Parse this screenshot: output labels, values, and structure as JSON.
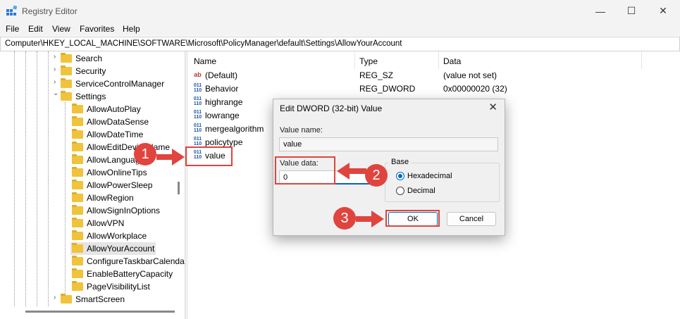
{
  "window": {
    "title": "Registry Editor",
    "minimize": "—",
    "maximize": "☐",
    "close": "✕"
  },
  "menu": [
    "File",
    "Edit",
    "View",
    "Favorites",
    "Help"
  ],
  "address": "Computer\\HKEY_LOCAL_MACHINE\\SOFTWARE\\Microsoft\\PolicyManager\\default\\Settings\\AllowYourAccount",
  "tree": {
    "top": [
      {
        "label": "Search",
        "expander": "›"
      },
      {
        "label": "Security",
        "expander": "›"
      },
      {
        "label": "ServiceControlManager",
        "expander": "›"
      },
      {
        "label": "Settings",
        "expander": "⌄"
      }
    ],
    "children": [
      "AllowAutoPlay",
      "AllowDataSense",
      "AllowDateTime",
      "AllowEditDeviceName",
      "AllowLanguage",
      "AllowOnlineTips",
      "AllowPowerSleep",
      "AllowRegion",
      "AllowSignInOptions",
      "AllowVPN",
      "AllowWorkplace",
      "AllowYourAccount",
      "ConfigureTaskbarCalendar",
      "EnableBatteryCapacity",
      "PageVisibilityList"
    ],
    "bottom": {
      "label": "SmartScreen",
      "expander": "›"
    },
    "selected": "AllowYourAccount"
  },
  "list": {
    "headers": {
      "name": "Name",
      "type": "Type",
      "data": "Data"
    },
    "rows": [
      {
        "icon": "ab",
        "name": "(Default)",
        "type": "REG_SZ",
        "data": "(value not set)"
      },
      {
        "icon": "011\n110",
        "name": "Behavior",
        "type": "REG_DWORD",
        "data": "0x00000020 (32)"
      },
      {
        "icon": "011\n110",
        "name": "highrange",
        "type": "",
        "data": ""
      },
      {
        "icon": "011\n110",
        "name": "lowrange",
        "type": "",
        "data": ""
      },
      {
        "icon": "011\n110",
        "name": "mergealgorithm",
        "type": "",
        "data": ""
      },
      {
        "icon": "011\n110",
        "name": "policytype",
        "type": "",
        "data": ""
      },
      {
        "icon": "011\n110",
        "name": "value",
        "type": "",
        "data": ""
      }
    ]
  },
  "dialog": {
    "title": "Edit DWORD (32-bit) Value",
    "close": "✕",
    "value_name_label": "Value name:",
    "value_name": "value",
    "value_data_label": "Value data:",
    "value_data": "0",
    "base_label": "Base",
    "hex_label": "Hexadecimal",
    "dec_label": "Decimal",
    "ok": "OK",
    "cancel": "Cancel"
  },
  "callouts": [
    "1",
    "2",
    "3"
  ],
  "colors": {
    "callout": "#e0443e",
    "folder": "#f0c33c",
    "accent": "#0067c0"
  }
}
